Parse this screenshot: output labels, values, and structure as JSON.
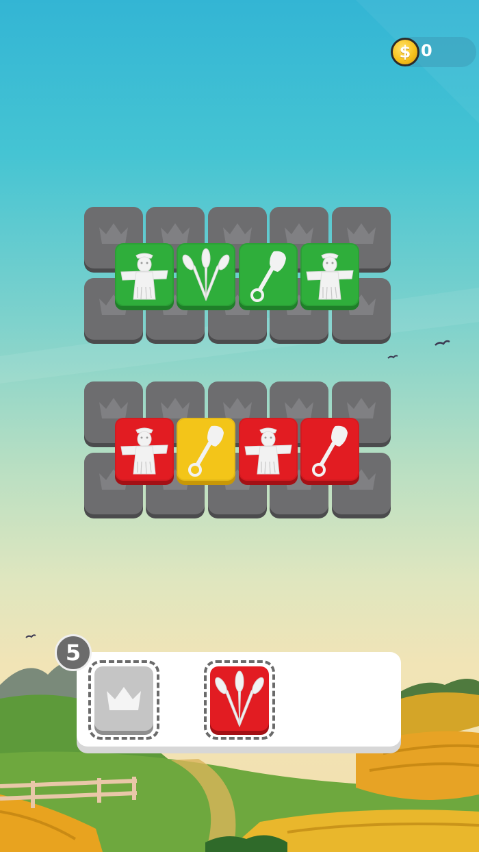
{
  "hud": {
    "coin_icon": "$",
    "coin_count": "0"
  },
  "board": {
    "top_group_tiles": [
      "scarecrow",
      "wheat",
      "shovel",
      "scarecrow"
    ],
    "top_group_color": "#2fae3b",
    "bottom_group_tiles": [
      {
        "icon": "scarecrow",
        "color": "red"
      },
      {
        "icon": "shovel",
        "color": "yellow"
      },
      {
        "icon": "scarecrow",
        "color": "red"
      },
      {
        "icon": "shovel",
        "color": "red"
      }
    ],
    "locked_tile_icon": "crown"
  },
  "tray": {
    "remaining_count": "5",
    "slots": [
      {
        "icon": "crown",
        "state": "empty"
      },
      {
        "icon": "wheat",
        "color": "red"
      }
    ]
  },
  "colors": {
    "green": "#2fae3b",
    "red": "#e21c22",
    "yellow": "#f3c519",
    "locked_gray": "#6d6d6f"
  }
}
